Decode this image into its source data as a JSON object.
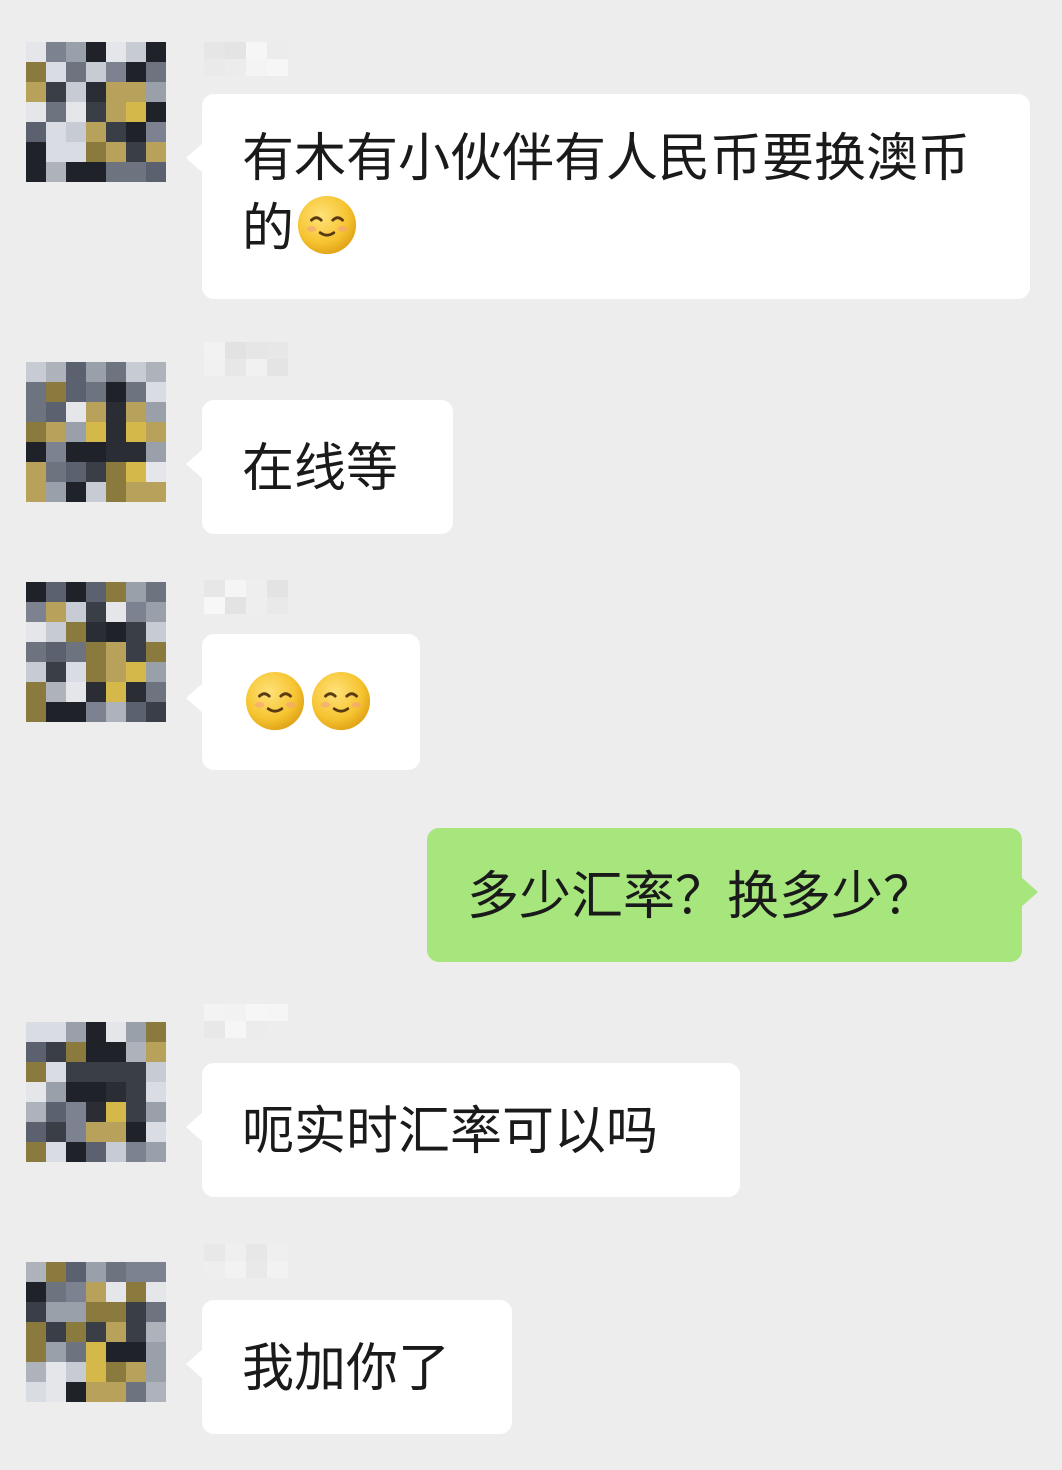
{
  "chat": {
    "messages": [
      {
        "sender": "other",
        "text": "有木有小伙伴有人民币要换澳币的",
        "emoji": [
          "pensive-smile"
        ]
      },
      {
        "sender": "other",
        "text": "在线等"
      },
      {
        "sender": "other",
        "text": "",
        "emoji": [
          "pensive-smile",
          "pensive-smile"
        ]
      },
      {
        "sender": "self",
        "text": "多少汇率？换多少？"
      },
      {
        "sender": "other",
        "text": "呃实时汇率可以吗"
      },
      {
        "sender": "other",
        "text": "我加你了"
      }
    ]
  },
  "colors": {
    "background": "#ededed",
    "incoming_bubble": "#ffffff",
    "outgoing_bubble": "#a6e67d",
    "text": "#1a1a1a"
  },
  "icons": {
    "emoji": "pensive-smile-emoji",
    "avatar": "pixelated-avatar"
  }
}
